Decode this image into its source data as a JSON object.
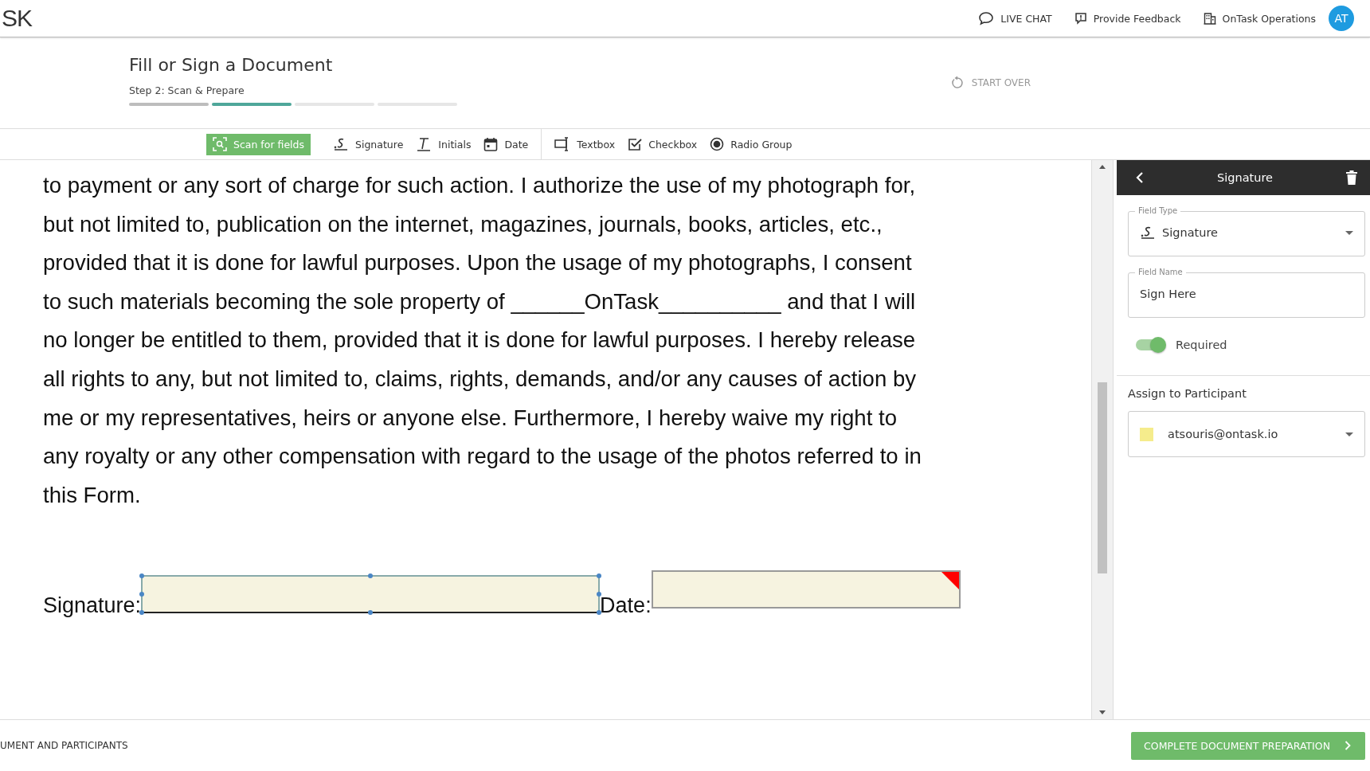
{
  "header": {
    "logo": "SK",
    "links": [
      {
        "kind": "chat",
        "label": "LIVE CHAT"
      },
      {
        "kind": "feedback",
        "label": "Provide Feedback"
      },
      {
        "kind": "org",
        "label": "OnTask Operations"
      }
    ],
    "avatar": "AT"
  },
  "page": {
    "title": "Fill or Sign a Document",
    "step": "Step 2: Scan & Prepare",
    "progress": [
      {
        "kind": "done"
      },
      {
        "kind": "current"
      },
      {
        "kind": "todo"
      },
      {
        "kind": "todo"
      }
    ],
    "start_over": "START OVER"
  },
  "toolbar": [
    {
      "kind": "scan",
      "label": "Scan for fields"
    },
    {
      "kind": "signature",
      "label": "Signature"
    },
    {
      "kind": "initials",
      "label": "Initials"
    },
    {
      "kind": "date",
      "label": "Date"
    },
    {
      "kind": "divider"
    },
    {
      "kind": "textbox",
      "label": "Textbox"
    },
    {
      "kind": "checkbox",
      "label": "Checkbox"
    },
    {
      "kind": "radio",
      "label": "Radio Group"
    }
  ],
  "document": {
    "paragraph": "to payment or any sort of charge for such action. I authorize the use of my photograph for, but not limited to, publication on the internet, magazines, journals, books, articles, etc., provided that it is done for lawful purposes. Upon the usage of my photographs, I consent to such materials becoming the sole property of ______OnTask__________ and that I will no longer be entitled to them, provided that it is done for lawful purposes. I hereby release all rights to any, but not limited to, claims, rights, demands, and/or any causes of action by me or my representatives, heirs or anyone else. Furthermore, I hereby waive my right to any royalty or any other compensation with regard to the usage of the photos referred to in this Form.",
    "fields": [
      {
        "label": "Signature:",
        "selected": true,
        "flagged": false
      },
      {
        "label": "Date:",
        "selected": false,
        "flagged": true
      }
    ]
  },
  "panel": {
    "title": "Signature",
    "field_type": {
      "label": "Field Type",
      "value": "Signature"
    },
    "field_name": {
      "label": "Field Name",
      "value": "Sign Here"
    },
    "required": {
      "label": "Required",
      "on": true
    },
    "assign": {
      "label": "Assign to Participant",
      "value": "atsouris@ontask.io",
      "color": "#f5ec8c"
    }
  },
  "footer": {
    "left": "UMENT AND PARTICIPANTS",
    "button": "COMPLETE DOCUMENT PREPARATION"
  }
}
